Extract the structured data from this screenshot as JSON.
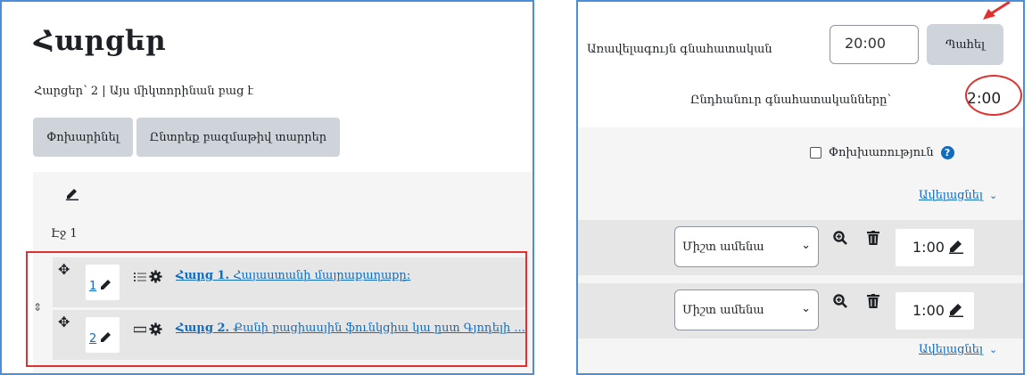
{
  "left": {
    "title": "Հարցեր",
    "subtitle": "Հարցեր՝ 2 | Այս միկտորինան բաց է",
    "buttons": {
      "repaginate": "Փոխարինել",
      "select_multiple": "Ընտրեք բազմաթիվ տարրեր"
    },
    "page_label": "Էջ 1",
    "questions": [
      {
        "slot": "1",
        "type_icon": "list-icon",
        "title_bold": "Հարց 1.",
        "title_rest": " Հայաստանի մայրաքաղաքը:"
      },
      {
        "slot": "2",
        "type_icon": "dash-icon",
        "title_bold": "Հարց 2.",
        "title_rest": " Քանի բացիասյին ֆունկցիա կա ըստ Գյոդելի ..."
      }
    ]
  },
  "right": {
    "max_grade_label": "Առավելագույն գնահատական",
    "max_grade_value": "20:00",
    "save_label": "Պահել",
    "total_label": "Ընդհանուր գնահատականները՝",
    "total_value": "2:00",
    "shuffle_label": "Փոխխառություն",
    "add_label": "Ավելացնել",
    "rows": [
      {
        "select_value": "Միշտ ամենա",
        "mark": "1:00"
      },
      {
        "select_value": "Միշտ ամենա",
        "mark": "1:00"
      }
    ]
  },
  "colors": {
    "link": "#0f6cbf",
    "annotation_red": "#e03131",
    "panel_border": "#4c8fd6"
  }
}
